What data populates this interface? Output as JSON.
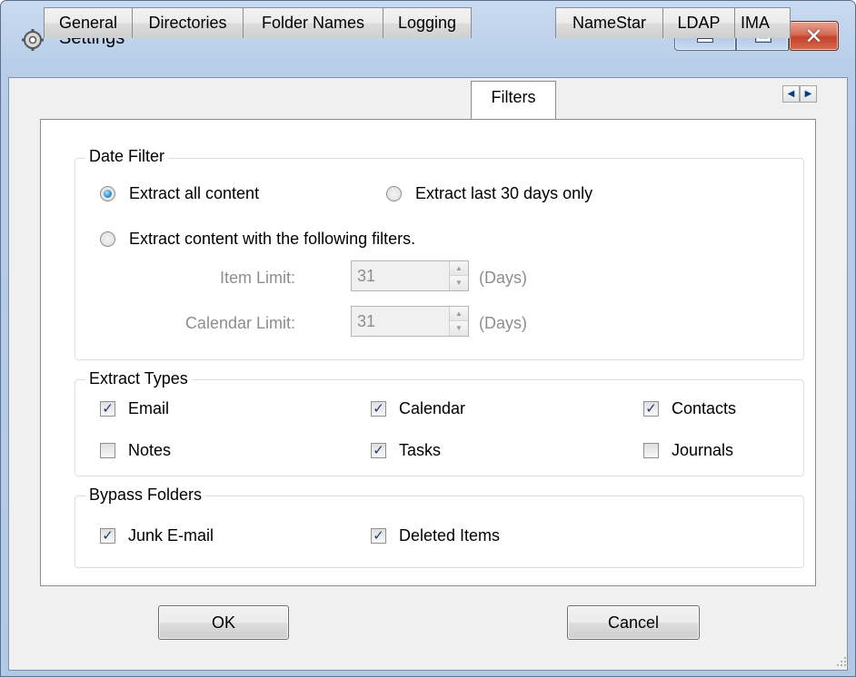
{
  "window": {
    "title": "Settings"
  },
  "tabs": [
    "General",
    "Directories",
    "Folder Names",
    "Logging",
    "Filters",
    "NameStar",
    "LDAP",
    "IMA"
  ],
  "active_tab": "Filters",
  "date_filter": {
    "label": "Date Filter",
    "option_all": "Extract all content",
    "option_last30": "Extract last 30 days only",
    "option_custom": "Extract content with the following filters.",
    "selected": "Extract all content",
    "item_limit_label": "Item Limit:",
    "item_limit_value": "31",
    "calendar_limit_label": "Calendar Limit:",
    "calendar_limit_value": "31",
    "unit": "(Days)"
  },
  "extract_types": {
    "label": "Extract Types",
    "items": [
      {
        "label": "Email",
        "checked": true
      },
      {
        "label": "Calendar",
        "checked": true
      },
      {
        "label": "Contacts",
        "checked": true
      },
      {
        "label": "Notes",
        "checked": false
      },
      {
        "label": "Tasks",
        "checked": true
      },
      {
        "label": "Journals",
        "checked": false
      }
    ]
  },
  "bypass_folders": {
    "label": "Bypass Folders",
    "items": [
      {
        "label": "Junk E-mail",
        "checked": true
      },
      {
        "label": "Deleted Items",
        "checked": true
      }
    ]
  },
  "buttons": {
    "ok": "OK",
    "cancel": "Cancel"
  },
  "colors": {
    "title_bar": "#b7cde9",
    "close_button": "#c4432c",
    "radio_selected": "#2d8ad3",
    "check_mark": "#1c3b71"
  }
}
